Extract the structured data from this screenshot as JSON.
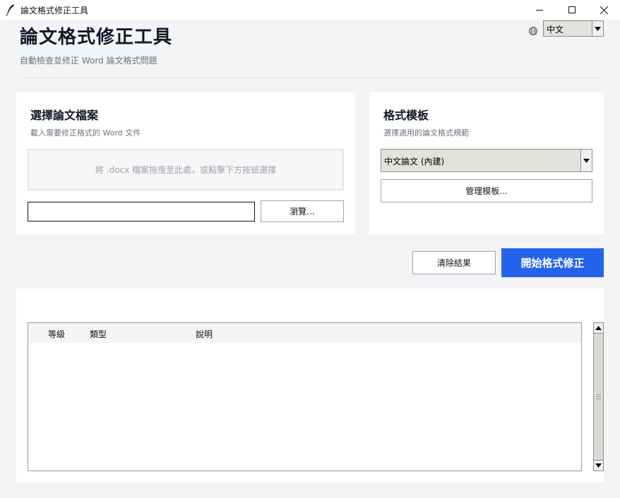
{
  "window": {
    "title": "論文格式修正工具",
    "icon": "quill-icon",
    "controls": [
      "minimize-icon",
      "maximize-icon",
      "close-icon"
    ]
  },
  "header": {
    "title": "論文格式修正工具",
    "subtitle": "自動檢查並修正 Word 論文格式問題",
    "language": {
      "icon": "globe-icon",
      "value": "中文"
    }
  },
  "file_card": {
    "title": "選擇論文檔案",
    "description": "載入需要修正格式的 Word 文件",
    "drop_text": "將 .docx 檔案拖曳至此處，或點擊下方按鈕選擇",
    "path_value": "",
    "browse_label": "瀏覽..."
  },
  "template_card": {
    "title": "格式模板",
    "description": "選擇適用的論文格式規範",
    "selected": "中文論文 (內建)",
    "manage_label": "管理模板..."
  },
  "actions": {
    "clear_label": "清除結果",
    "start_label": "開始格式修正"
  },
  "results": {
    "columns": [
      "等級",
      "類型",
      "說明"
    ],
    "rows": []
  },
  "colors": {
    "accent": "#2563eb",
    "background": "#f3f4f6",
    "card": "#ffffff"
  }
}
